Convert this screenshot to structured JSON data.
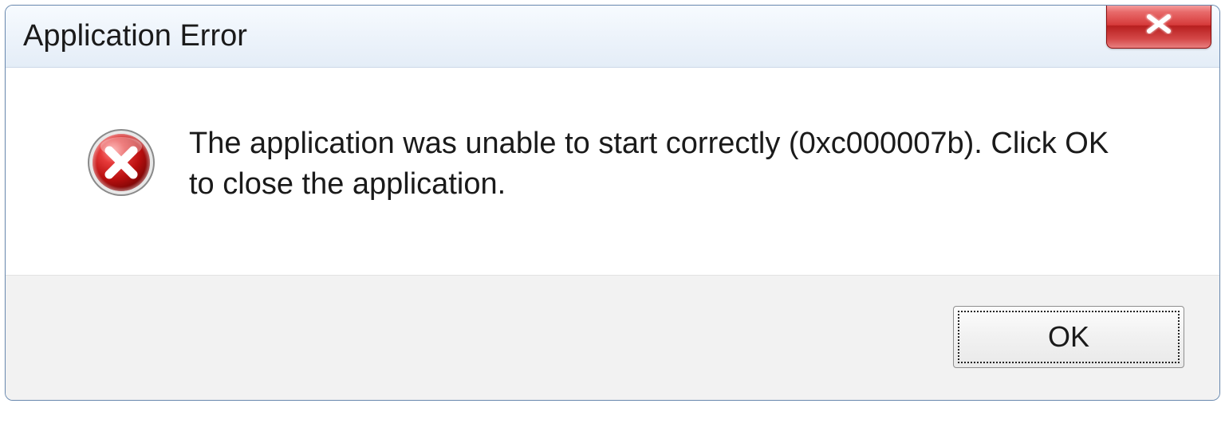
{
  "dialog": {
    "title": "Application Error",
    "message": "The application was unable to start correctly (0xc000007b). Click OK to close the application.",
    "ok_label": "OK"
  }
}
